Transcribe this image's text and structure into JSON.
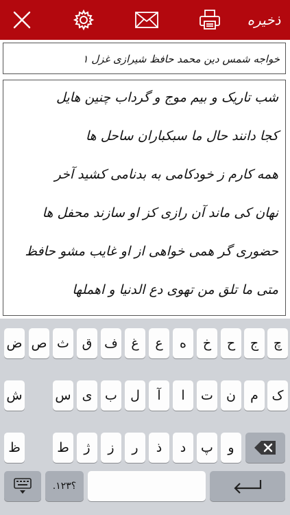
{
  "toolbar": {
    "save_label": "ذخیره",
    "icons": [
      "close-icon",
      "gear-icon",
      "mail-icon",
      "printer-icon"
    ],
    "background": "#b3080e"
  },
  "title": "خواجه شمس دین محمد حافظ شیرازی غزل ۱",
  "poem": {
    "lines": [
      "شب تاریک و بیم موج و گرداب چنین هایل",
      "کجا دانند حال ما سبکباران ساحل ها",
      "همه کارم ز خودکامی به بدنامی کشید آخر",
      "نهان کی ماند آن رازی کز او سازند محفل ها",
      "حضوری گر همی خواهی از او غایب مشو حافظ",
      "متی ما تلق من تهوی دع الدنیا و اهملها"
    ]
  },
  "keyboard": {
    "row1": [
      "چ",
      "ج",
      "ح",
      "خ",
      "ه",
      "ع",
      "غ",
      "ف",
      "ق",
      "ث",
      "ص",
      "ض"
    ],
    "row2": [
      "ک",
      "م",
      "ن",
      "ت",
      "ا",
      "آ",
      "ل",
      "ب",
      "ی",
      "س",
      "ش"
    ],
    "row3": [
      "و",
      "پ",
      "د",
      "ذ",
      "ر",
      "ز",
      "ژ",
      "ط",
      "ظ"
    ],
    "numbers_label": ".؟۱۲۳",
    "background": "#d0d3d8"
  }
}
